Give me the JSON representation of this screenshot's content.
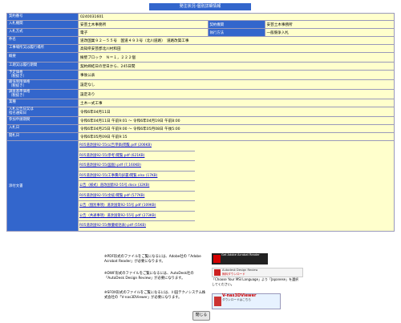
{
  "title": "発注状況-個別詳細情報",
  "rows": [
    {
      "label": "契約番号",
      "value": "0240031601"
    },
    {
      "label": "入札機関",
      "value": "安芸土木事務所",
      "label2": "契約機関",
      "value2": "安芸土木事務所"
    },
    {
      "label": "入札方式",
      "value": "電子",
      "label2": "執行方法",
      "value2": "一般競争入札"
    },
    {
      "label": "件名",
      "value": "道改国業９２－５５号　国道４９３号（北川道路）　道路改築工事"
    },
    {
      "label": "工事場所又は履行場所",
      "value": "高知県安芸郡北川村和田"
    },
    {
      "label": "概要",
      "value": "擁壁ブロック　Ｎ＝１，２２２個"
    },
    {
      "label": "工期又は履行期間",
      "value": "契約締結日の翌日から、245日間"
    },
    {
      "label": "予定価格\n（税抜き）",
      "value": "事後公表"
    },
    {
      "label": "最低制限価格\n（税抜き）",
      "value": "設定なし"
    },
    {
      "label": "調査基準価格\n（税抜き）",
      "value": "設定あり"
    },
    {
      "label": "業種",
      "value": "土木一式工事"
    },
    {
      "label": "入札公告日又は\n指名通知日",
      "value": "令和6年04月11日"
    },
    {
      "label": "参加申請期間",
      "value": "令和6年04月11日 午前9:01 〜 令和6年04月19日 午前8:00"
    },
    {
      "label": "入札日",
      "value": "令和6年04月25日 午前9:00 〜 令和6年05月08日 午後5:00"
    },
    {
      "label": "開札日",
      "value": "令和6年05月09日 午前9:15"
    }
  ],
  "documents": {
    "label": "添付文書",
    "files": [
      "R05道改国92-55(公告単価)閲覧.pdf (206KB)",
      "R05道改国92-55(参考)閲覧.pdf (621KB)",
      "R05道改国92-55(図面).pdf (7,160KB)",
      "R05道改国92-55(工事費内訳書)閲覧.xlsx (17KB)",
      "公告（様式）道改国第92-55号.docx (32KB)",
      "R05道改国92-55(金抜)閲覧.pdf (577KB)",
      "公告（個別事項）道改国第92-55号.pdf (109KB)",
      "公告（共通事項）道改国第92-55号.pdf (273KB)",
      "R05道改国92-55(数量総括表).pdf (55KB)"
    ]
  },
  "notes": [
    "※PDF形式のファイルをご覧になるには、Adobe社の「Adobe Acrobat Reader」が必要になります。",
    "※DWF形式のファイルをご覧になるには、AutoDesk社の「AutoDesk Design Review」が必要になります。",
    "※SFOX形式のファイルをご覧になるには、川田テクノシステム株式会社の「V-nas3DViewer」が必要になります。"
  ],
  "badges": {
    "acrobat": "Get Adobe Acrobat Reader",
    "adr_line1": "Autodesk Design Review",
    "adr_line2": "無料ダウンロード",
    "adr_note": "「Choose Your MSI Language」より「Japanese」を選択してください。",
    "vnas": "V-nas3DViewer",
    "vnas_sub": "ダウンロードはこちら"
  },
  "close_label": "閉じる"
}
